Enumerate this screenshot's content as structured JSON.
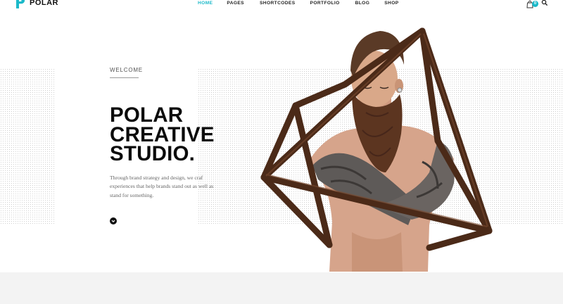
{
  "header": {
    "logo_text": "POLAR",
    "nav": [
      {
        "label": "HOME",
        "active": true
      },
      {
        "label": "PAGES",
        "active": false
      },
      {
        "label": "SHORTCODES",
        "active": false
      },
      {
        "label": "PORTFOLIO",
        "active": false
      },
      {
        "label": "BLOG",
        "active": false
      },
      {
        "label": "SHOP",
        "active": false
      }
    ],
    "cart_count": "0",
    "accent_color": "#1bb9c9"
  },
  "hero": {
    "eyebrow": "WELCOME",
    "headline_lines": [
      "POLAR",
      "CREATIVE",
      "STUDIO."
    ],
    "description": "Through brand strategy and design, we craf experiences that help brands stand out as well as stand for something."
  }
}
